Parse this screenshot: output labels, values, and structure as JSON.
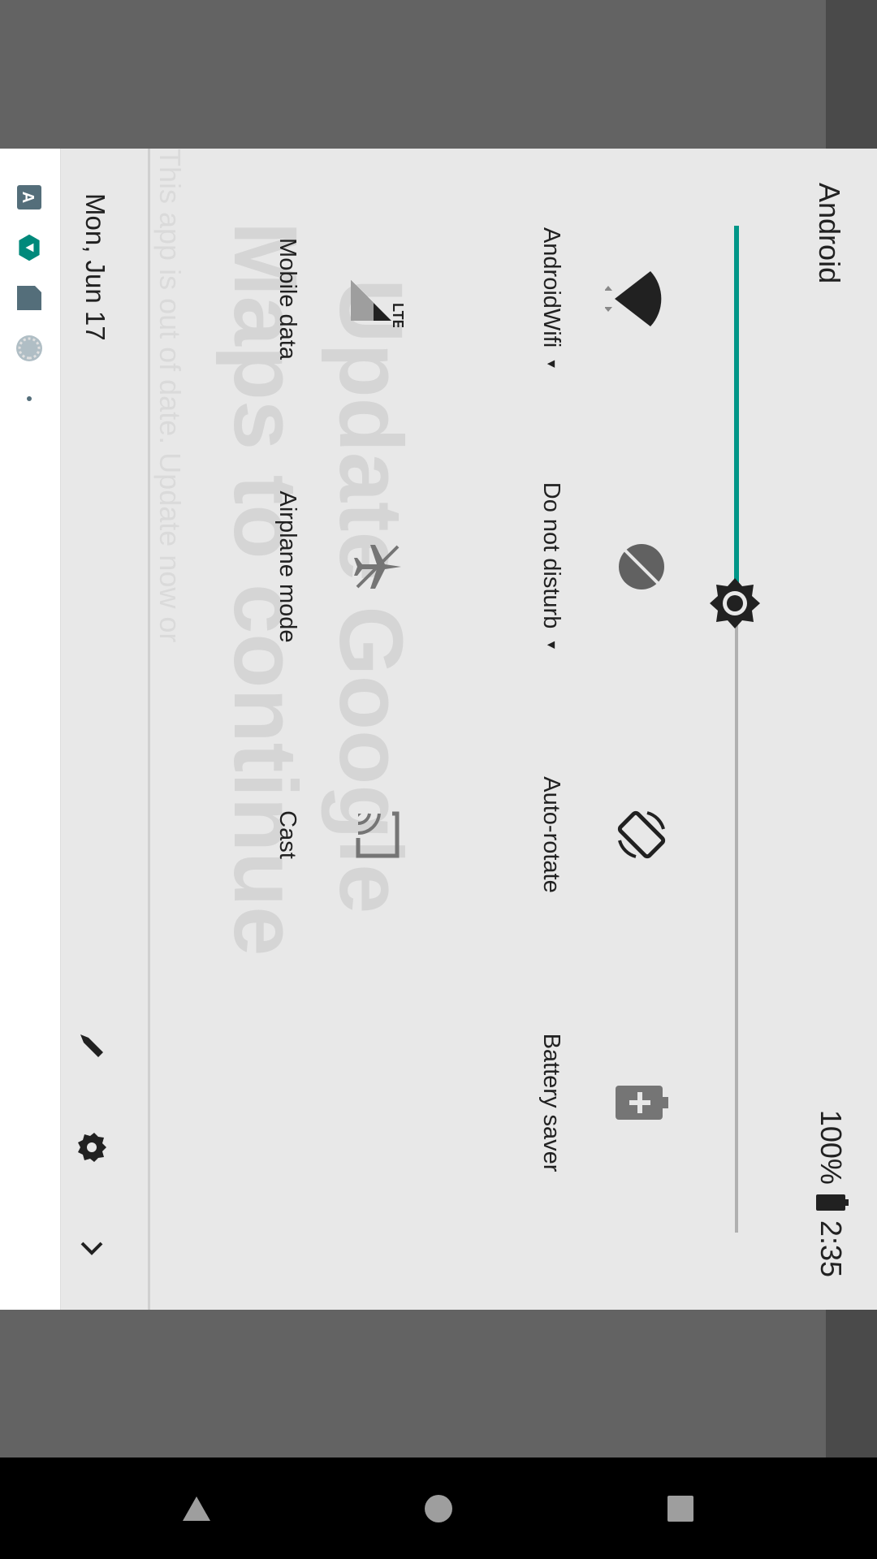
{
  "panel": {
    "title": "Android",
    "battery_percent": "100%",
    "time": "2:35",
    "date": "Mon, Jun 17"
  },
  "brightness": {
    "level": 0.375,
    "accent": "#009688"
  },
  "tiles": [
    {
      "label": "AndroidWifi",
      "icon": "wifi-icon",
      "has_dropdown": true
    },
    {
      "label": "Do not disturb",
      "icon": "dnd-icon",
      "has_dropdown": true
    },
    {
      "label": "Auto-rotate",
      "icon": "auto-rotate-icon",
      "has_dropdown": false
    },
    {
      "label": "Battery saver",
      "icon": "battery-saver-icon",
      "has_dropdown": false
    },
    {
      "label": "Mobile data",
      "icon": "mobile-data-icon",
      "has_dropdown": false,
      "badge": "LTE"
    },
    {
      "label": "Airplane mode",
      "icon": "airplane-icon",
      "has_dropdown": false
    },
    {
      "label": "Cast",
      "icon": "cast-icon",
      "has_dropdown": false
    }
  ],
  "background_app": {
    "headline_line1": "Update Google",
    "headline_line2": "Maps to continue",
    "body": "This app is out of date. Update now or"
  },
  "notification_icons": [
    "app-store-icon",
    "play-icon",
    "sd-card-icon",
    "loading-icon",
    "more-dot-icon"
  ]
}
